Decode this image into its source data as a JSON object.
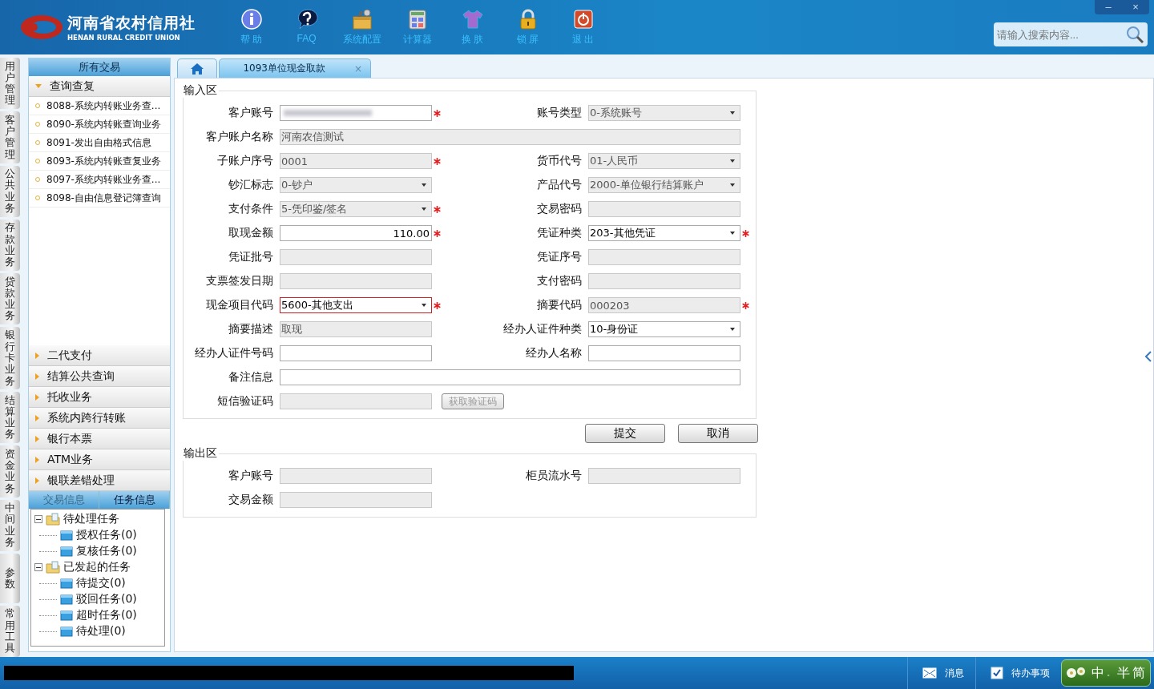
{
  "header": {
    "logo_cn": "河南省农村信用社",
    "logo_en": "HENAN RURAL CREDIT UNION",
    "tools": [
      {
        "label": "帮 助",
        "kind": "info"
      },
      {
        "label": "FAQ",
        "kind": "question"
      },
      {
        "label": "系统配置",
        "kind": "toolbox"
      },
      {
        "label": "计算器",
        "kind": "calculator"
      },
      {
        "label": "换 肤",
        "kind": "shirt"
      },
      {
        "label": "锁 屏",
        "kind": "lock"
      },
      {
        "label": "退 出",
        "kind": "power"
      }
    ],
    "window_buttons": [
      "–",
      "×"
    ],
    "search": {
      "placeholder": "请输入搜索内容..."
    }
  },
  "side_tabs": [
    "用户管理",
    "客户管理",
    "公共业务",
    "存款业务",
    "贷款业务",
    "银行卡业务",
    "结算业务",
    "资金业务",
    "中间业务",
    "参数",
    "常用工具"
  ],
  "sidebar": {
    "title": "所有交易",
    "groups": [
      {
        "label": "查询查复",
        "expanded": true,
        "items": [
          "8088-系统内转账业务查...",
          "8090-系统内转账查询业务",
          "8091-发出自由格式信息",
          "8093-系统内转账查复业务",
          "8097-系统内转账业务查...",
          "8098-自由信息登记簿查询"
        ]
      },
      {
        "label": "二代支付",
        "expanded": false
      },
      {
        "label": "结算公共查询",
        "expanded": false
      },
      {
        "label": "托收业务",
        "expanded": false
      },
      {
        "label": "系统内跨行转账",
        "expanded": false
      },
      {
        "label": "银行本票",
        "expanded": false
      },
      {
        "label": "ATM业务",
        "expanded": false
      },
      {
        "label": "银联差错处理",
        "expanded": false
      }
    ],
    "info_tabs": [
      {
        "label": "交易信息",
        "selected": false
      },
      {
        "label": "任务信息",
        "selected": true
      }
    ],
    "tree": [
      {
        "label": "待处理任务",
        "expanded": true,
        "children": [
          {
            "label": "授权任务(0)"
          },
          {
            "label": "复核任务(0)"
          }
        ]
      },
      {
        "label": "已发起的任务",
        "expanded": true,
        "children": [
          {
            "label": "待提交(0)"
          },
          {
            "label": "驳回任务(0)"
          },
          {
            "label": "超时任务(0)"
          },
          {
            "label": "待处理(0)"
          }
        ]
      }
    ]
  },
  "tabs": [
    {
      "kind": "home",
      "selected": false
    },
    {
      "kind": "page",
      "label": "1093单位现金取款",
      "close": "×",
      "selected": true
    }
  ],
  "input_area": {
    "title": "输入区",
    "rows": [
      [
        {
          "label": "客户账号",
          "kind": "redacted",
          "disabled": false,
          "required": true
        },
        {
          "label": "账号类型",
          "kind": "select",
          "value": "0-系统账号",
          "disabled": true
        }
      ],
      [
        {
          "label": "客户账户名称",
          "kind": "wide",
          "value": "河南农信测试",
          "disabled": true
        }
      ],
      [
        {
          "label": "子账户序号",
          "value": "0001",
          "disabled": true,
          "required": true
        },
        {
          "label": "货币代号",
          "kind": "select",
          "value": "01-人民币",
          "disabled": true
        }
      ],
      [
        {
          "label": "钞汇标志",
          "kind": "select",
          "value": "0-钞户",
          "disabled": true
        },
        {
          "label": "产品代号",
          "kind": "select",
          "value": "2000-单位银行结算账户",
          "disabled": true
        }
      ],
      [
        {
          "label": "支付条件",
          "kind": "select",
          "value": "5-凭印鉴/签名",
          "disabled": true,
          "required": true
        },
        {
          "label": "交易密码",
          "disabled": true
        }
      ],
      [
        {
          "label": "取现金额",
          "kind": "amount",
          "value": "110.00",
          "disabled": false,
          "required": true
        },
        {
          "label": "凭证种类",
          "kind": "select",
          "value": "203-其他凭证",
          "disabled": false,
          "required": true
        }
      ],
      [
        {
          "label": "凭证批号",
          "disabled": true
        },
        {
          "label": "凭证序号",
          "disabled": true
        }
      ],
      [
        {
          "label": "支票签发日期",
          "disabled": true
        },
        {
          "label": "支付密码",
          "disabled": true
        }
      ],
      [
        {
          "label": "现金项目代码",
          "kind": "select",
          "value": "5600-其他支出",
          "disabled": false,
          "required": true,
          "invalid": true
        },
        {
          "label": "摘要代码",
          "value": "000203",
          "disabled": true,
          "required": true
        }
      ],
      [
        {
          "label": "摘要描述",
          "value": "取现",
          "disabled": true
        },
        {
          "label": "经办人证件种类",
          "kind": "select",
          "value": "10-身份证",
          "disabled": false
        }
      ],
      [
        {
          "label": "经办人证件号码",
          "disabled": false
        },
        {
          "label": "经办人名称",
          "disabled": false
        }
      ],
      [
        {
          "label": "备注信息",
          "kind": "wide",
          "disabled": false
        }
      ],
      [
        {
          "label": "短信验证码",
          "disabled": true
        },
        {
          "label": "获取验证码",
          "kind": "button",
          "disabled": true
        }
      ]
    ]
  },
  "actions": [
    "提交",
    "取消"
  ],
  "output_area": {
    "title": "输出区",
    "rows": [
      [
        {
          "label": "客户账号",
          "disabled": true
        },
        {
          "label": "柜员流水号",
          "disabled": true
        }
      ],
      [
        {
          "label": "交易金额",
          "disabled": true
        }
      ]
    ]
  },
  "status_bar": {
    "items": [
      {
        "label": "消息",
        "kind": "mail"
      },
      {
        "label": "待办事项",
        "kind": "check"
      }
    ],
    "ime": [
      "中",
      "。",
      "半",
      "简"
    ]
  }
}
